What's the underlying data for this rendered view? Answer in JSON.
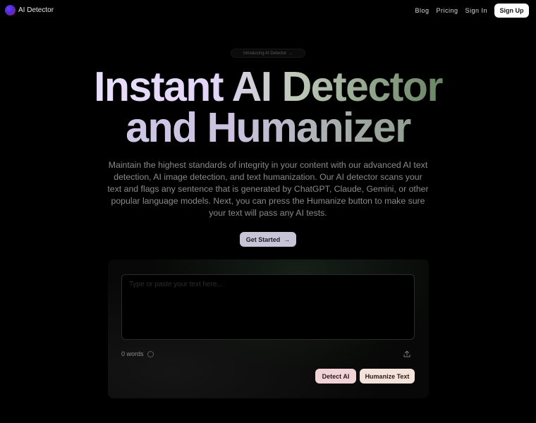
{
  "header": {
    "logo_text": "AI Detector",
    "nav": [
      "Blog",
      "Pricing",
      "Sign In"
    ],
    "signup_label": "Sign Up"
  },
  "badge": {
    "text": "Introducing AI Detector",
    "arrow": "→"
  },
  "hero": {
    "title_line1": "Instant AI Detector",
    "title_line2": "and Humanizer",
    "subtitle": "Maintain the highest standards of integrity in your content with our advanced AI text detection, AI image detection, and text humanization. Our AI detector scans your text and flags any sentence that is generated by ChatGPT, Claude, Gemini, or other popular language models. Next, you can press the Humanize button to make sure your text will pass any AI tests.",
    "cta_label": "Get Started",
    "cta_arrow": "→"
  },
  "editor": {
    "placeholder": "Type or paste your text here...",
    "value": "",
    "word_count": "0 words",
    "detect_label": "Detect AI",
    "humanize_label": "Humanize Text"
  },
  "icons": {
    "logo": "logo-icon",
    "info": "info-icon",
    "upload": "upload-icon",
    "arrow": "arrow-right-icon"
  },
  "colors": {
    "background": "#000000",
    "signup_bg": "#ffffff",
    "cta_bg": "#c8c4d8",
    "detect_bg": "#f1d2d6",
    "humanize_bg": "#f4e3db"
  }
}
